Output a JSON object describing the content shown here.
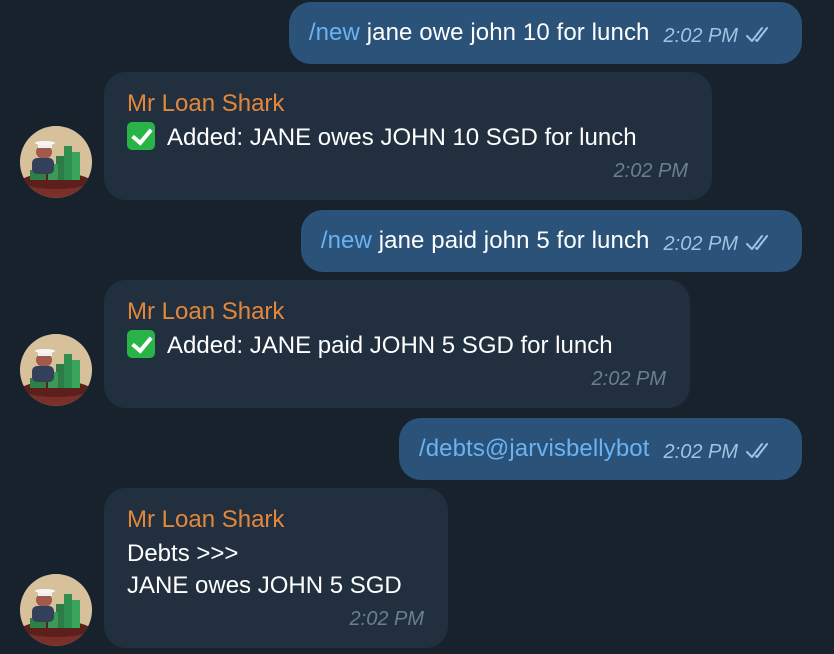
{
  "colors": {
    "background": "#18222d",
    "outgoing_bubble": "#2b5278",
    "incoming_bubble": "#212f3f",
    "command_link": "#6ab3f3",
    "sender_name": "#e3883b",
    "check_emoji": "#28b446"
  },
  "messages": [
    {
      "direction": "outgoing",
      "command": "/new",
      "text": " jane owe john 10 for lunch",
      "time": "2:02 PM",
      "status_icon": "double-check-icon"
    },
    {
      "direction": "incoming",
      "sender": "Mr Loan Shark",
      "emoji": "check-mark-button-emoji",
      "text": "Added: JANE owes JOHN 10 SGD for lunch",
      "time": "2:02 PM"
    },
    {
      "direction": "outgoing",
      "command": "/new",
      "text": " jane paid john 5 for lunch",
      "time": "2:02 PM",
      "status_icon": "double-check-icon"
    },
    {
      "direction": "incoming",
      "sender": "Mr Loan Shark",
      "emoji": "check-mark-button-emoji",
      "text": "Added: JANE paid JOHN 5 SGD for lunch",
      "time": "2:02 PM"
    },
    {
      "direction": "outgoing",
      "command": "/debts@jarvisbellybot",
      "text": "",
      "time": "2:02 PM",
      "status_icon": "double-check-icon"
    },
    {
      "direction": "incoming",
      "sender": "Mr Loan Shark",
      "line1": "Debts >>>",
      "line2": "JANE owes JOHN 5 SGD",
      "time": "2:02 PM"
    }
  ]
}
